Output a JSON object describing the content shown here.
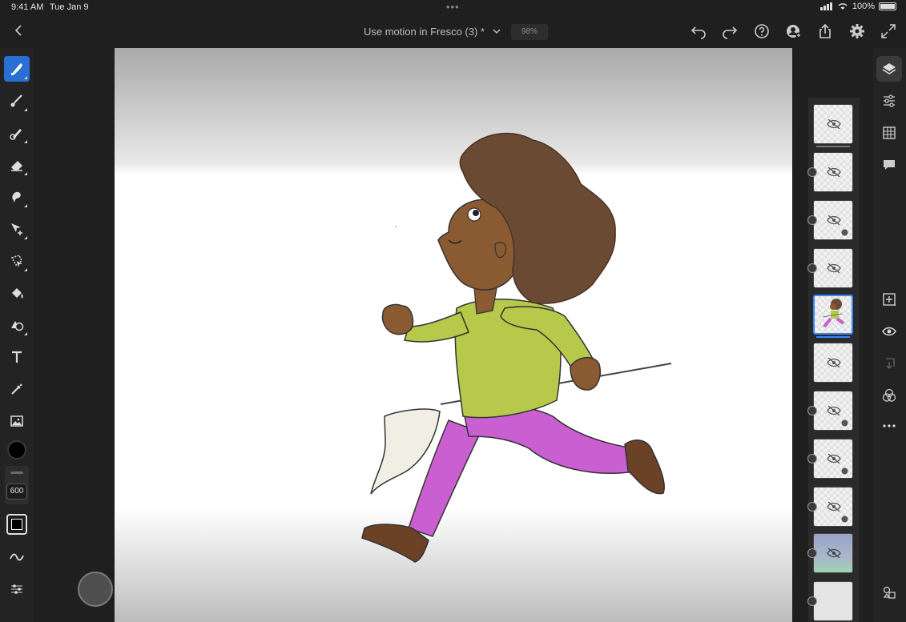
{
  "status_bar": {
    "time": "9:41 AM",
    "date": "Tue Jan 9",
    "battery": "100%"
  },
  "title_bar": {
    "document_title": "Use motion in Fresco (3) *",
    "zoom": "98%"
  },
  "left_toolbar": {
    "tools": [
      {
        "name": "pixel-brush",
        "active": true
      },
      {
        "name": "live-brush"
      },
      {
        "name": "vector-brush"
      },
      {
        "name": "eraser"
      },
      {
        "name": "smudge"
      },
      {
        "name": "transform"
      },
      {
        "name": "selection"
      },
      {
        "name": "fill"
      },
      {
        "name": "shapes"
      },
      {
        "name": "type"
      },
      {
        "name": "eyedropper"
      },
      {
        "name": "place-image"
      }
    ],
    "current_color": "#000000",
    "brush_size": "600"
  },
  "layers": {
    "count": 11,
    "selected_index": 4
  },
  "right_toolbar": {
    "items": [
      "layers",
      "layer-properties",
      "grid",
      "comments",
      "add-layer",
      "visibility",
      "layer-actions",
      "blend",
      "more",
      "share-links"
    ]
  },
  "colors": {
    "accent": "#2a6fd3",
    "selection": "#3b86f7",
    "skin": "#8a5a33",
    "hair": "#6b4a33",
    "shirt": "#b6c94a",
    "pants": "#c95fd1",
    "shoes": "#6b4226"
  }
}
